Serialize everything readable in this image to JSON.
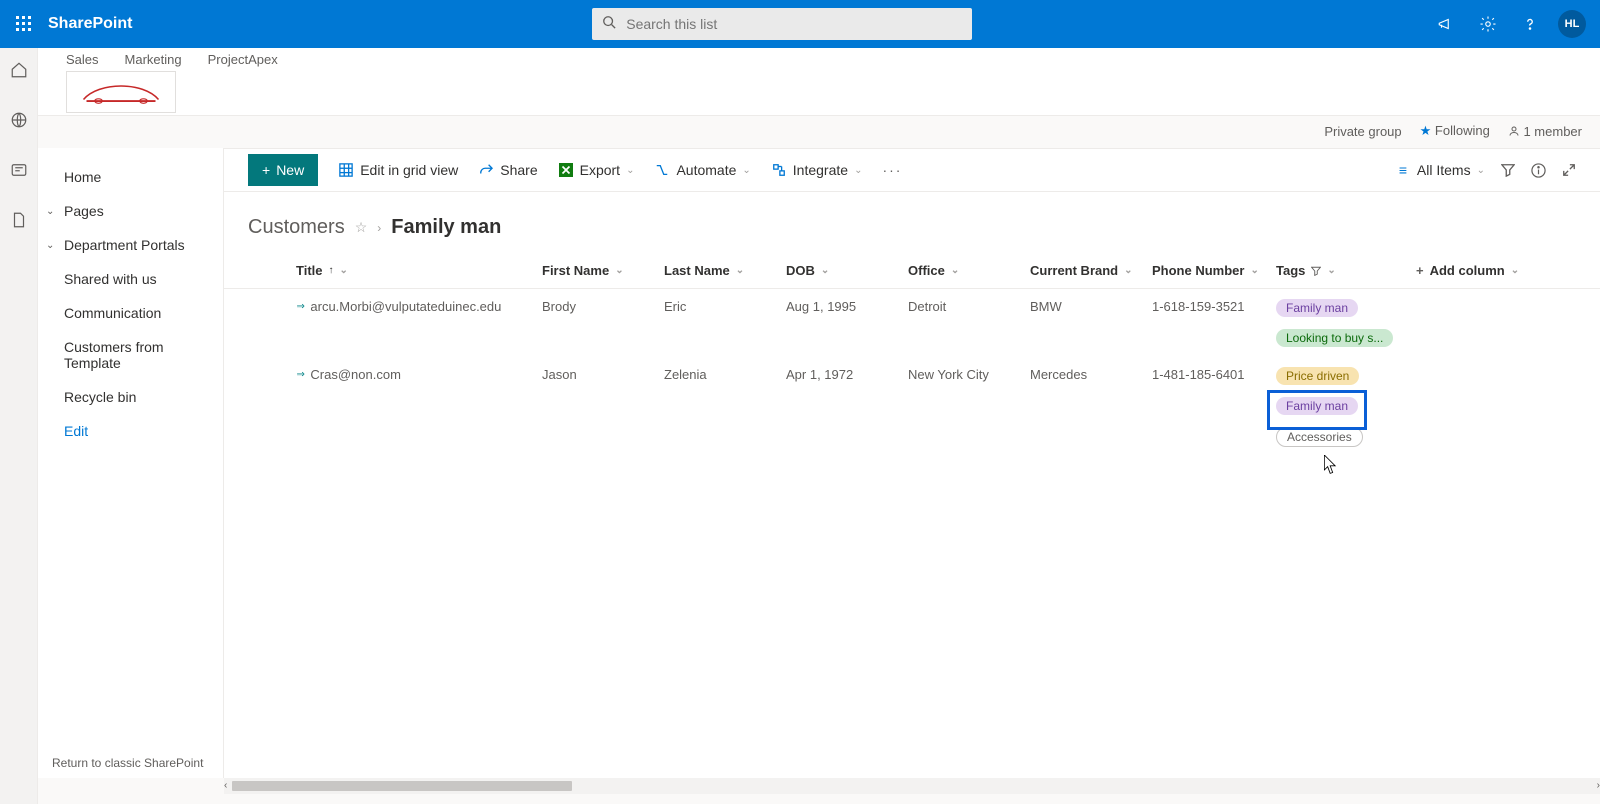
{
  "suite": {
    "app": "SharePoint",
    "search_placeholder": "Search this list",
    "avatar": "HL"
  },
  "hub_links": [
    "Sales",
    "Marketing",
    "ProjectApex"
  ],
  "group_bar": {
    "privacy": "Private group",
    "follow": "Following",
    "members": "1 member"
  },
  "left_nav": {
    "items": [
      "Home",
      "Pages",
      "Department Portals",
      "Shared with us",
      "Communication",
      "Customers from Template",
      "Recycle bin"
    ],
    "edit": "Edit",
    "return": "Return to classic SharePoint"
  },
  "cmd": {
    "new": "New",
    "grid": "Edit in grid view",
    "share": "Share",
    "export": "Export",
    "automate": "Automate",
    "integrate": "Integrate",
    "view": "All Items"
  },
  "breadcrumb": {
    "parent": "Customers",
    "current": "Family man"
  },
  "columns": {
    "title": "Title",
    "fname": "First Name",
    "lname": "Last Name",
    "dob": "DOB",
    "office": "Office",
    "brand": "Current Brand",
    "phone": "Phone Number",
    "tags": "Tags",
    "add": "Add column"
  },
  "rows": [
    {
      "title": "arcu.Morbi@vulputateduinec.edu",
      "fname": "Brody",
      "lname": "Eric",
      "dob": "Aug 1, 1995",
      "office": "Detroit",
      "brand": "BMW",
      "phone": "1-618-159-3521",
      "tags": [
        {
          "text": "Family man",
          "style": "purple"
        },
        {
          "text": "Looking to buy s...",
          "style": "green"
        }
      ]
    },
    {
      "title": "Cras@non.com",
      "fname": "Jason",
      "lname": "Zelenia",
      "dob": "Apr 1, 1972",
      "office": "New York City",
      "brand": "Mercedes",
      "phone": "1-481-185-6401",
      "tags": [
        {
          "text": "Price driven",
          "style": "yellow"
        },
        {
          "text": "Family man",
          "style": "purple"
        },
        {
          "text": "Accessories",
          "style": "grey"
        }
      ]
    }
  ]
}
